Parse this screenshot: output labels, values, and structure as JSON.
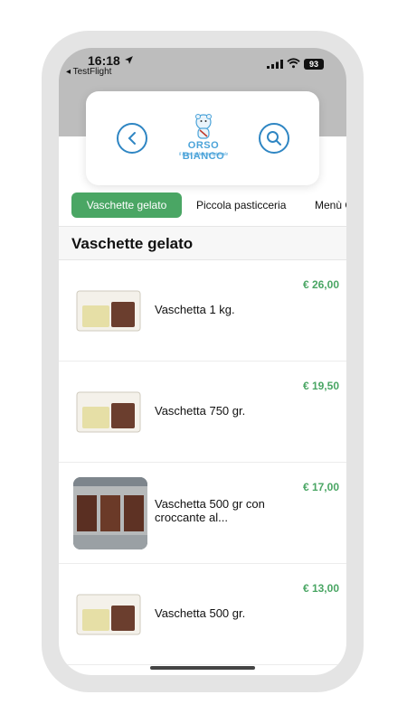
{
  "status": {
    "time": "16:18",
    "back_app": "◂ TestFlight",
    "battery": "93"
  },
  "header": {
    "logo_name": "ORSO BIANCO",
    "logo_tagline": "il buon gelato artigianale"
  },
  "tabs": [
    {
      "label": "Vaschette gelato",
      "active": true
    },
    {
      "label": "Piccola pasticceria",
      "active": false
    },
    {
      "label": "Menù G",
      "active": false
    }
  ],
  "section": {
    "title": "Vaschette gelato"
  },
  "products": [
    {
      "name": "Vaschetta 1 kg.",
      "price": "€ 26,00"
    },
    {
      "name": "Vaschetta 750 gr.",
      "price": "€ 19,50"
    },
    {
      "name": "Vaschetta 500 gr con croccante al...",
      "price": "€ 17,00"
    },
    {
      "name": "Vaschetta 500 gr.",
      "price": "€ 13,00"
    }
  ],
  "colors": {
    "accent_green": "#4aa664",
    "icon_blue": "#2f86c3"
  }
}
